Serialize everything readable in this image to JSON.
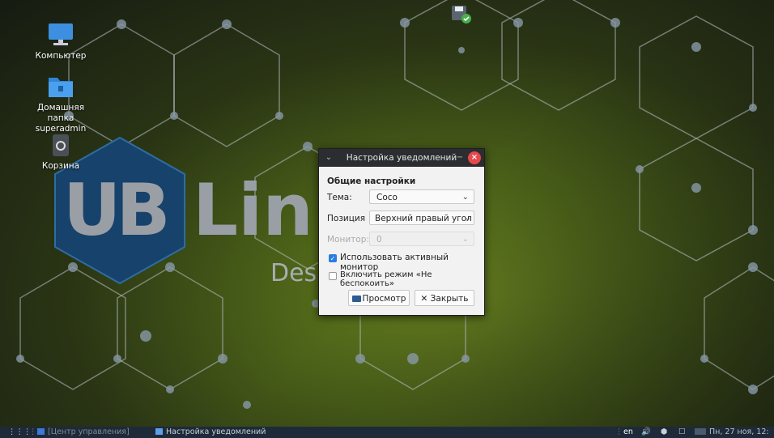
{
  "desktop": {
    "icons": [
      {
        "label": "Компьютер",
        "icon": "computer-icon"
      },
      {
        "label": "Домашняя папка superadmin",
        "icon": "home-folder-icon"
      },
      {
        "label": "Корзина",
        "icon": "trash-icon"
      }
    ],
    "brand": {
      "logo": "UB",
      "text": "Lin",
      "sub": "Desk"
    }
  },
  "dialog": {
    "title": "Настройка уведомлений",
    "section": "Общие настройки",
    "theme": {
      "label": "Тема:",
      "value": "Coco"
    },
    "position": {
      "label": "Позиция",
      "value": "Верхний правый угол"
    },
    "monitor": {
      "label": "Монитор:",
      "value": "0"
    },
    "use_active_monitor": {
      "label": "Использовать активный монитор",
      "checked": true
    },
    "dnd": {
      "label": "Включить режим «Не беспокоить»",
      "checked": false
    },
    "preview_button": "Просмотр",
    "close_button": "✕ Закрыть"
  },
  "taskbar": {
    "items": [
      "[Центр управления]",
      "Настройка уведомлений"
    ],
    "lang": "en",
    "clock": "Пн, 27 ноя, 12:"
  },
  "colors": {
    "accent": "#2b7de1",
    "close": "#e5484d",
    "taskbar": "#1e2a3a"
  }
}
